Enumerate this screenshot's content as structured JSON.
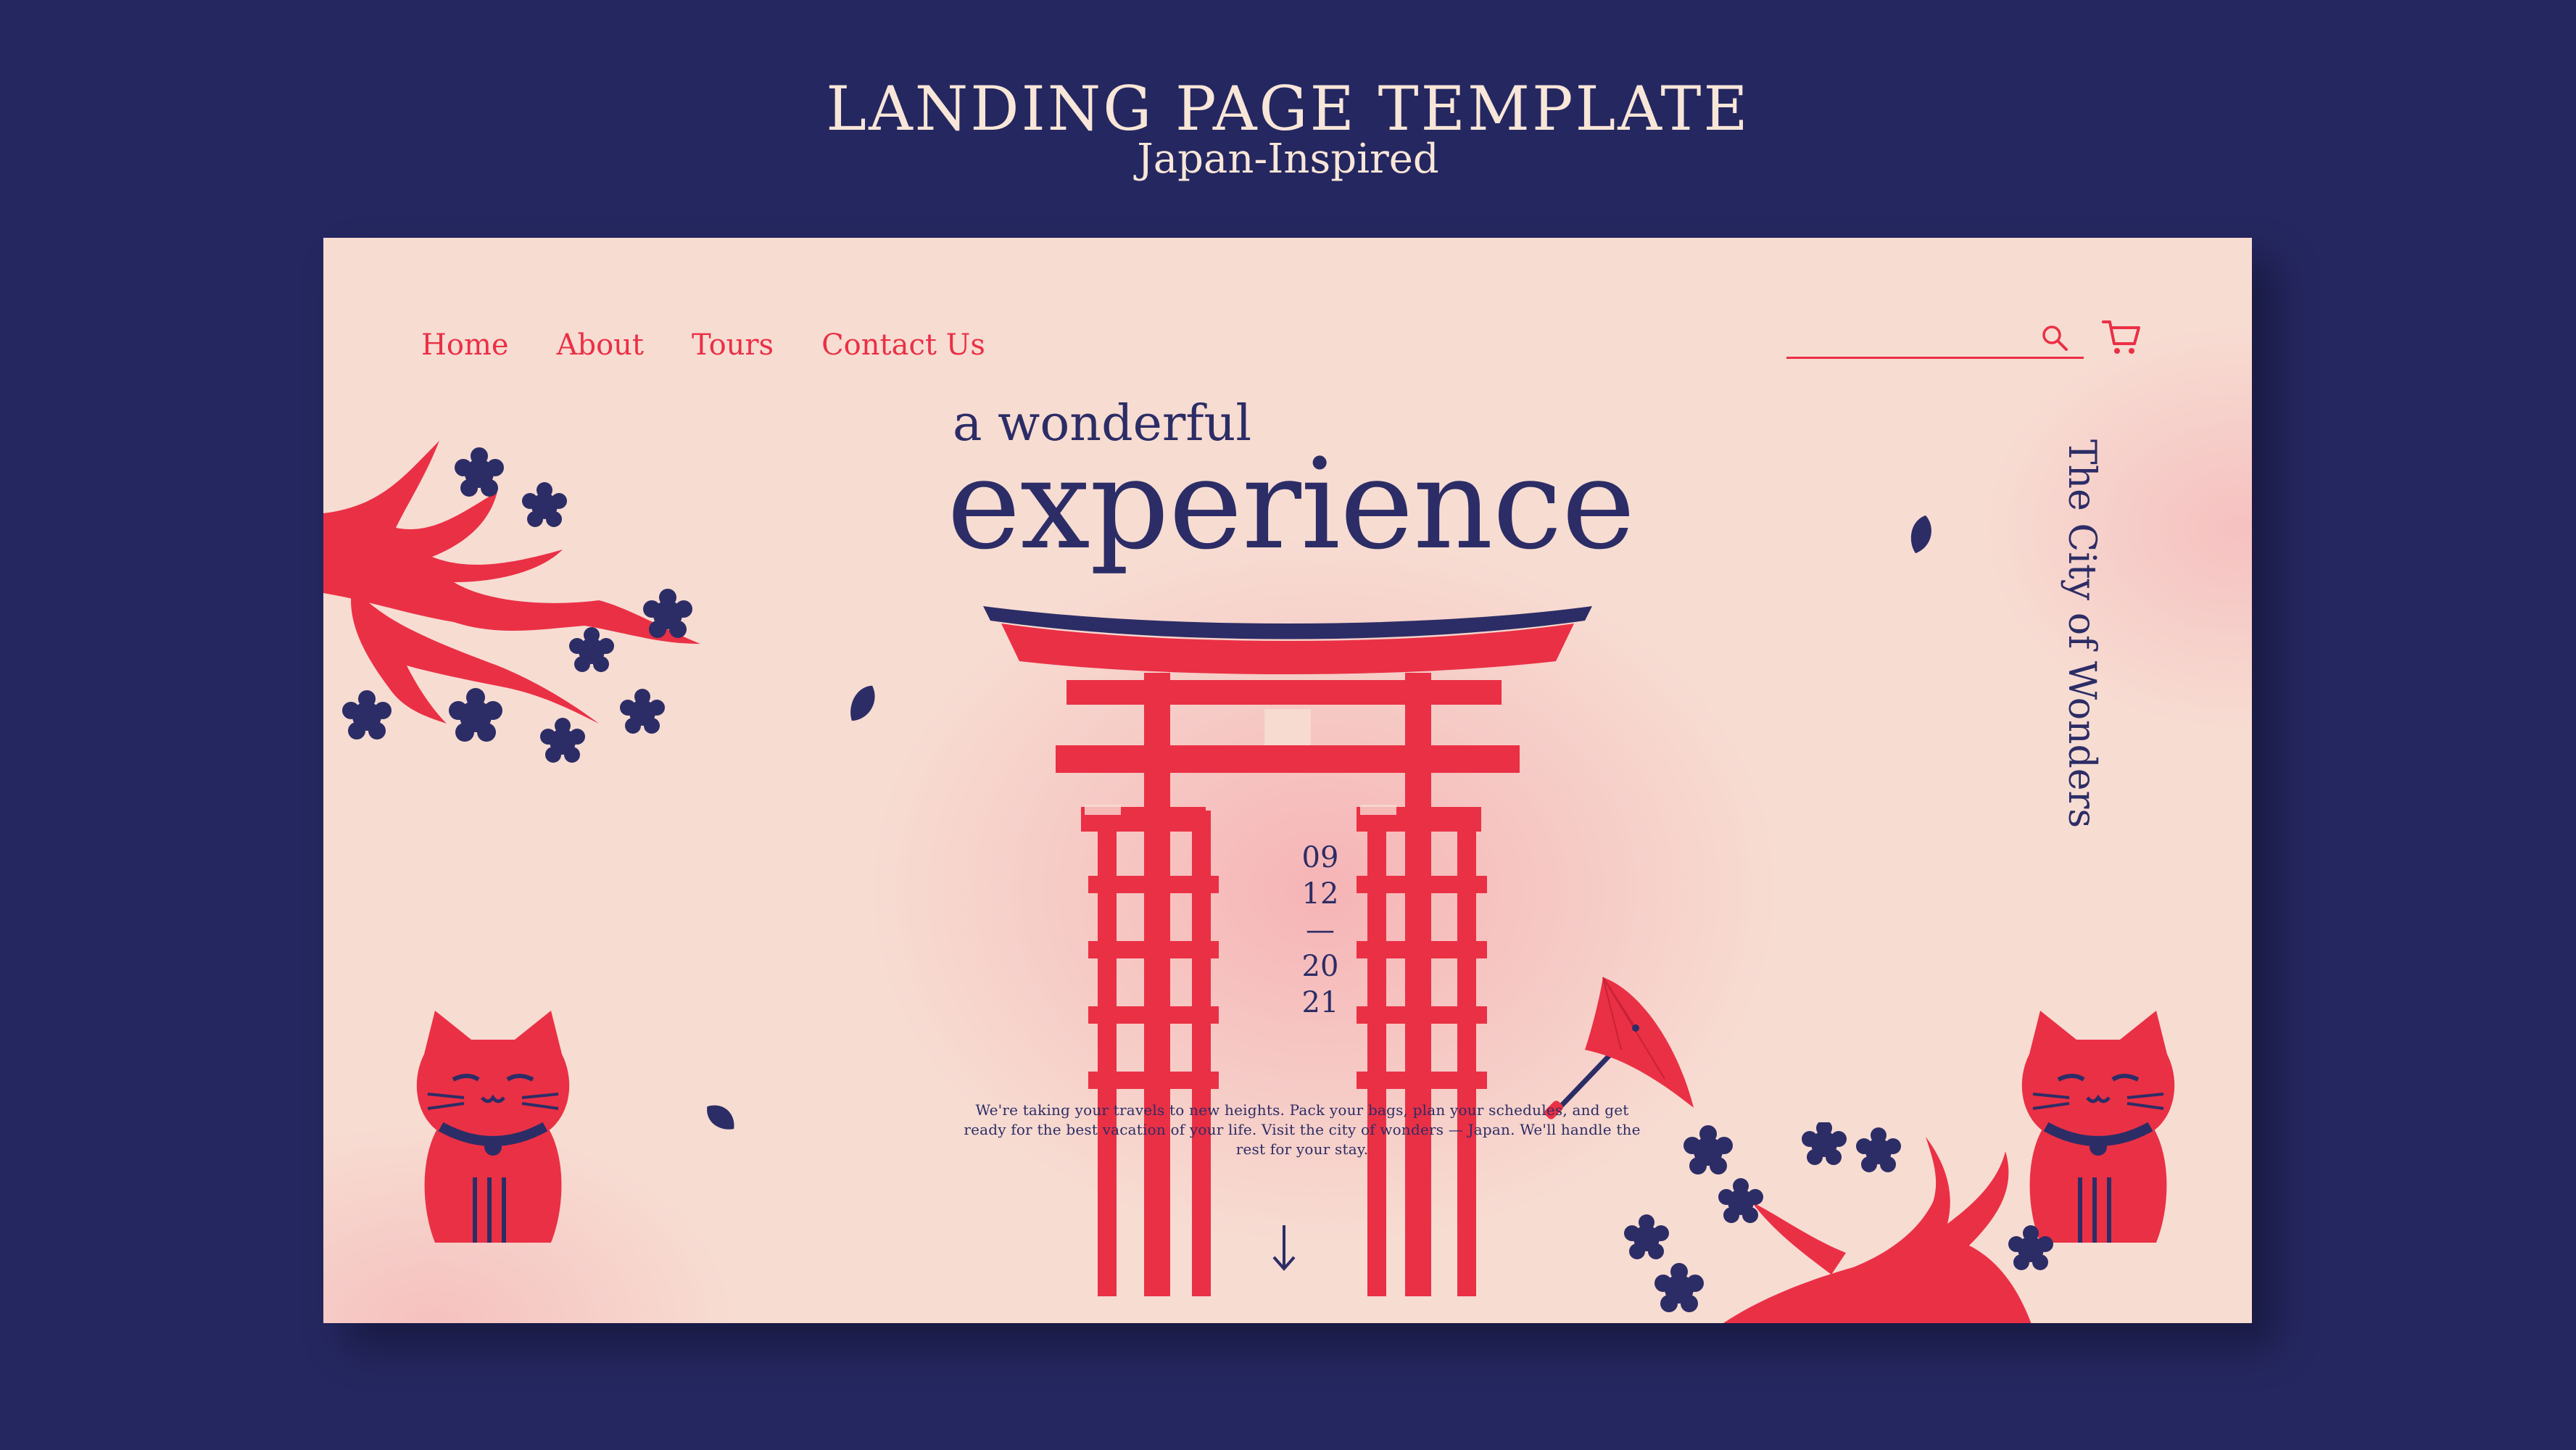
{
  "showcase": {
    "title": "LANDING PAGE TEMPLATE",
    "subtitle": "Japan-Inspired"
  },
  "nav": {
    "items": [
      "Home",
      "About",
      "Tours",
      "Contact Us"
    ]
  },
  "search": {
    "placeholder": "",
    "icon": "search-icon"
  },
  "cart": {
    "icon": "cart-icon"
  },
  "hero": {
    "kicker": "a wonderful",
    "title": "experience",
    "side_text": "The City of Wonders",
    "date": {
      "line1": "09",
      "line2": "12",
      "separator": "—",
      "line3": "20",
      "line4": "21"
    },
    "description": "We're taking your travels to new heights. Pack your bags, plan your schedules, and get ready for the best vacation of your life. Visit the city of wonders — Japan. We'll handle the rest for your stay."
  },
  "scroll": {
    "icon": "arrow-down-icon"
  },
  "colors": {
    "background": "#252760",
    "card": "#f7dcd2",
    "accent_red": "#ea3045",
    "navy": "#2c2d66",
    "cream_text": "#f8e6d8"
  }
}
